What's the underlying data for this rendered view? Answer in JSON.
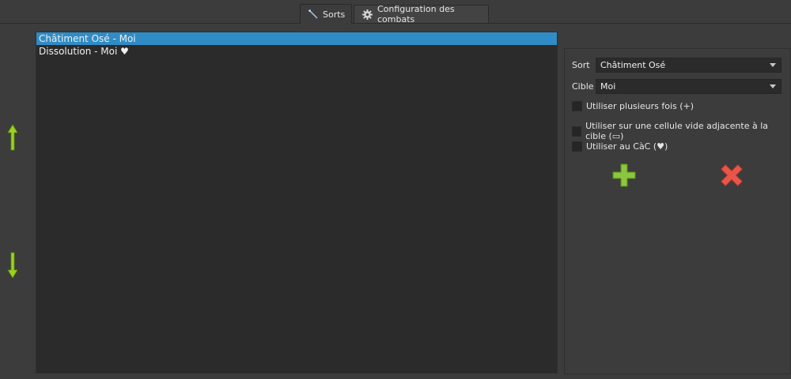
{
  "tabs": [
    {
      "label": "Sorts",
      "icon": "wand-icon",
      "active": true
    },
    {
      "label": "Configuration des combats",
      "icon": "gear-icon",
      "active": false
    }
  ],
  "spell_list": {
    "items": [
      {
        "label": "Châtiment Osé - Moi",
        "selected": true
      },
      {
        "label": "Dissolution - Moi ♥",
        "selected": false
      }
    ]
  },
  "move_buttons": {
    "up_icon": "arrow-up-icon",
    "down_icon": "arrow-down-icon"
  },
  "form": {
    "spell_label": "Sort",
    "spell_value": "Châtiment Osé",
    "target_label": "Cible",
    "target_value": "Moi",
    "checkboxes": [
      {
        "label": "Utiliser plusieurs fois (+)",
        "checked": false
      },
      {
        "label": "Utiliser sur une cellule vide adjacente à la cible (▭)",
        "checked": false
      },
      {
        "label": "Utiliser au CàC (♥)",
        "checked": false
      }
    ],
    "add_icon": "plus-icon",
    "delete_icon": "cross-icon"
  },
  "colors": {
    "selection": "#308cc6",
    "arrow_green": "#9ad321",
    "add_green": "#8cc63f",
    "delete_red": "#e8564a"
  }
}
